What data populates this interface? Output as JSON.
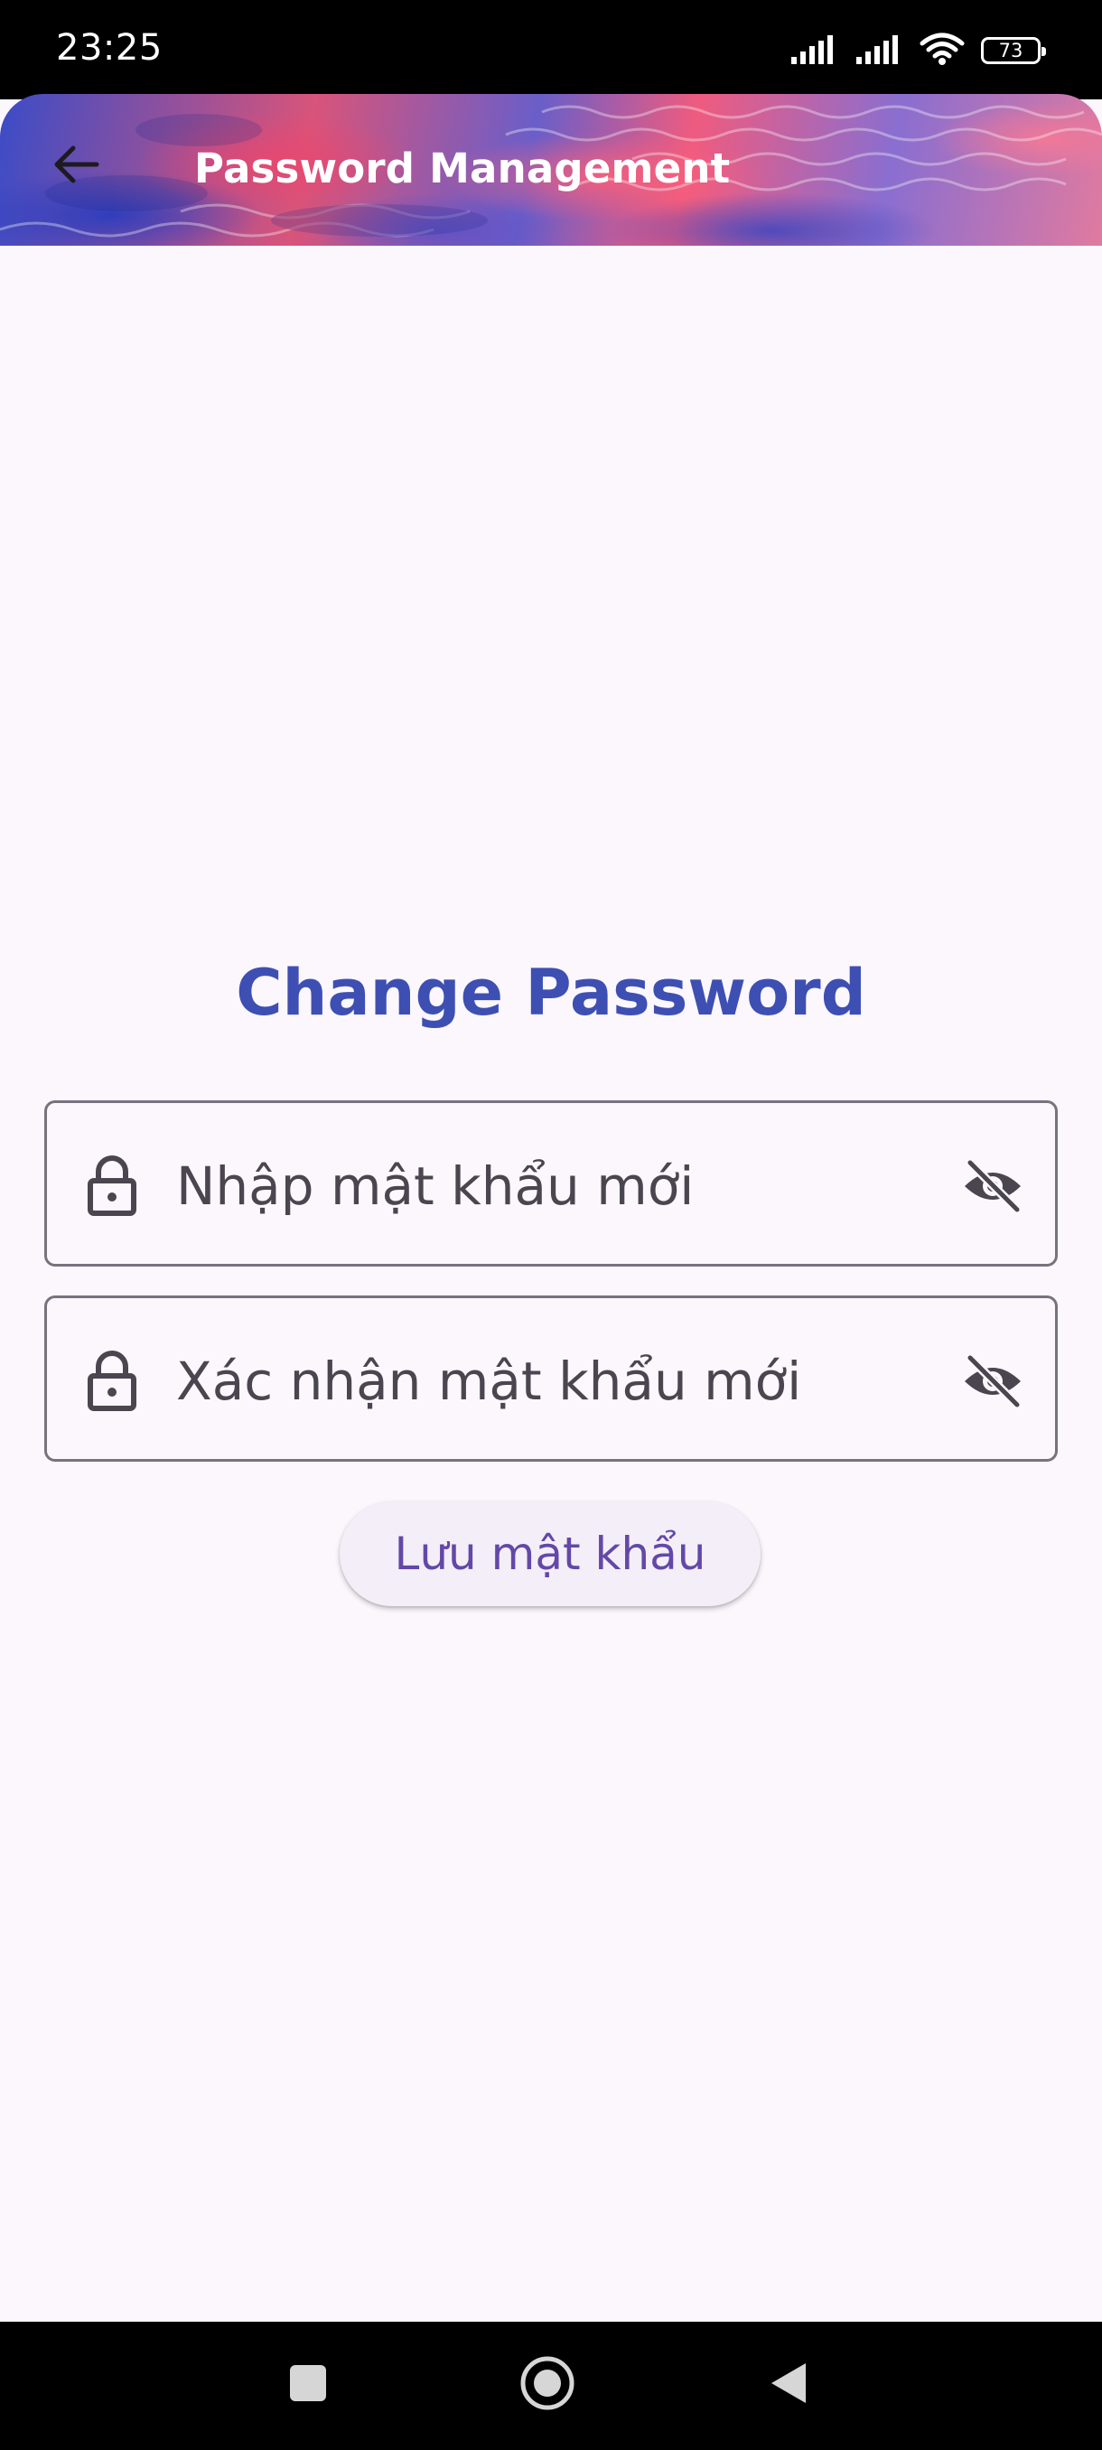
{
  "status_bar": {
    "time": "23:25",
    "battery_level": "73",
    "icons": [
      "signal-icon",
      "signal-icon",
      "wifi-icon",
      "battery-icon"
    ]
  },
  "app_bar": {
    "title": "Password Management",
    "back_icon": "arrow-back-icon"
  },
  "form": {
    "heading": "Change Password",
    "new_password": {
      "placeholder": "Nhập mật khẩu mới",
      "value": "",
      "leading_icon": "lock-icon",
      "trailing_icon": "eye-off-icon"
    },
    "confirm_password": {
      "placeholder": "Xác nhận mật khẩu mới",
      "value": "",
      "leading_icon": "lock-icon",
      "trailing_icon": "eye-off-icon"
    },
    "save_label": "Lưu mật khẩu"
  },
  "nav_bar": {
    "buttons": [
      "recent-apps-icon",
      "home-icon",
      "back-icon"
    ]
  },
  "colors": {
    "heading": "#3e4fb3",
    "button_text": "#6348a8",
    "background": "#fbf7fd",
    "field_border": "#77737e"
  }
}
